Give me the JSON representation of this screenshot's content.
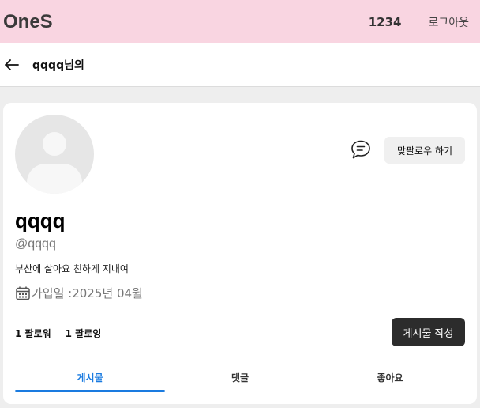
{
  "topbar": {
    "brand": "OneS",
    "user_id": "1234",
    "logout_label": "로그아웃"
  },
  "subheader": {
    "back_icon": "arrow-left-icon",
    "title": "qqqq님의"
  },
  "profile": {
    "display_name": "qqqq",
    "handle": "@qqqq",
    "bio": "부산에 살아요 친하게 지내여",
    "joined": "가입일 :2025년 04월",
    "followers": "1 팔로워",
    "following": "1 팔로잉",
    "follow_button": "맞팔로우 하기",
    "write_button": "게시물 작성",
    "chat_icon": "chat-bubble-icon",
    "calendar_icon": "calendar-icon"
  },
  "tabs": [
    {
      "label": "게시물",
      "active": true
    },
    {
      "label": "댓글",
      "active": false
    },
    {
      "label": "좋아요",
      "active": false
    }
  ],
  "colors": {
    "topbar_bg": "#f9d5e1",
    "accent": "#1a7be0",
    "dark_button": "#2c2c2c"
  }
}
